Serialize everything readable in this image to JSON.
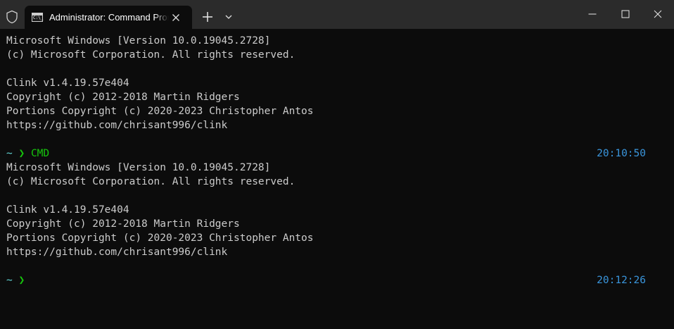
{
  "titlebar": {
    "tab_title": "Administrator: Command Prompt",
    "tab_icon_text": "C:\\_",
    "icons": [
      "shield-icon",
      "cmd-icon",
      "close-icon",
      "plus-icon",
      "chevron-down-icon",
      "minimize-icon",
      "maximize-icon",
      "window-close-icon"
    ]
  },
  "terminal": {
    "block1": [
      "Microsoft Windows [Version 10.0.19045.2728]",
      "(c) Microsoft Corporation. All rights reserved.",
      "",
      "Clink v1.4.19.57e404",
      "Copyright (c) 2012-2018 Martin Ridgers",
      "Portions Copyright (c) 2020-2023 Christopher Antos",
      "https://github.com/chrisant996/clink"
    ],
    "prompt1": {
      "tilde": "~",
      "chevron": "❯",
      "command": "CMD",
      "time": "20:10:50"
    },
    "block2": [
      "Microsoft Windows [Version 10.0.19045.2728]",
      "(c) Microsoft Corporation. All rights reserved.",
      "",
      "Clink v1.4.19.57e404",
      "Copyright (c) 2012-2018 Martin Ridgers",
      "Portions Copyright (c) 2020-2023 Christopher Antos",
      "https://github.com/chrisant996/clink"
    ],
    "prompt2": {
      "tilde": "~",
      "chevron": "❯",
      "command": "",
      "time": "20:12:26"
    }
  },
  "colors": {
    "background": "#0c0c0c",
    "titlebar": "#2b2b2b",
    "text": "#cccccc",
    "prompt_tilde": "#61d6d6",
    "prompt_chevron": "#16c60c",
    "time": "#3a96dd"
  }
}
